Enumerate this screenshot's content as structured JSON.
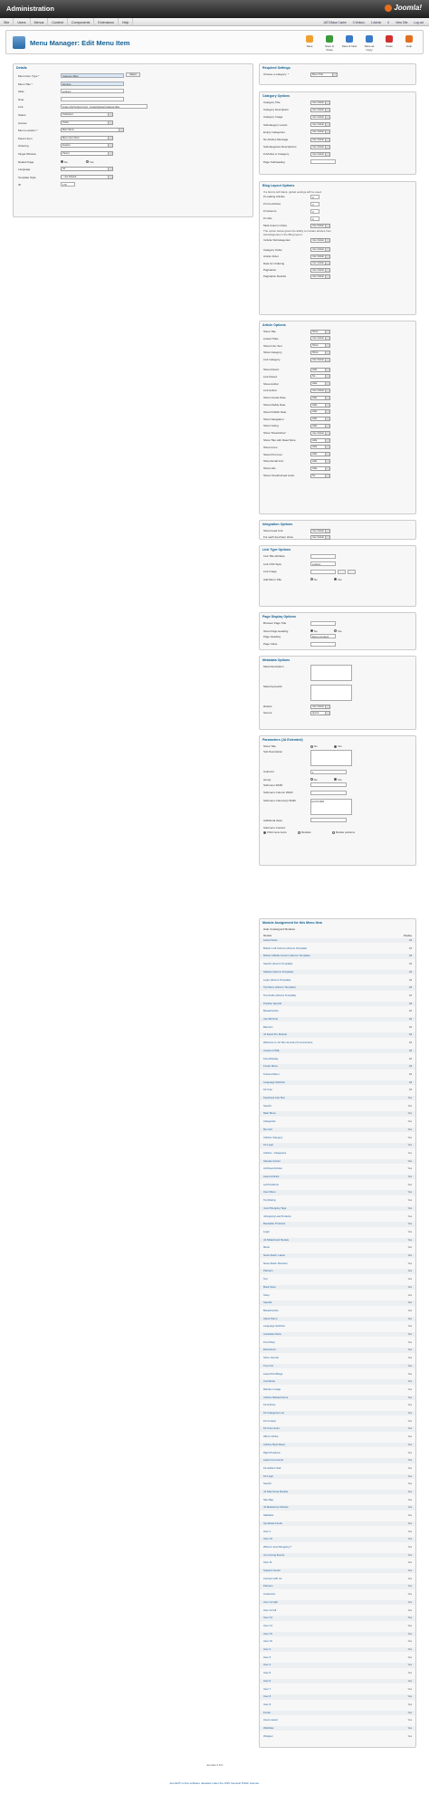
{
  "header": {
    "title": "Administration",
    "logo": "Joomla!"
  },
  "menubar": {
    "items": [
      "Site",
      "Users",
      "Menus",
      "Content",
      "Components",
      "Extensions",
      "Help"
    ],
    "right": [
      "JAT3 Base Cache",
      "0 Visitors",
      "1 Admin",
      "0",
      "View Site",
      "Log out"
    ]
  },
  "toolbar": {
    "page_title": "Menu Manager: Edit Menu Item",
    "buttons": [
      "Save",
      "Save & Close",
      "Save & New",
      "Save as Copy",
      "Close",
      "Help"
    ]
  },
  "details": {
    "title": "Details",
    "fields": [
      {
        "label": "Menu Item Type *",
        "value": "Category Blog",
        "kind": "ro"
      },
      {
        "label": "Menu Title *",
        "value": "Explore",
        "kind": "ro"
      },
      {
        "label": "Alias",
        "value": "explore",
        "kind": "input"
      },
      {
        "label": "Note",
        "value": "",
        "kind": "input"
      },
      {
        "label": "Link",
        "value": "index.php?option=com_content&view=category&la",
        "kind": "input"
      },
      {
        "label": "Status",
        "value": "Published",
        "kind": "select"
      },
      {
        "label": "Access",
        "value": "Public",
        "kind": "select"
      },
      {
        "label": "Menu Location *",
        "value": "Main Menu",
        "kind": "select"
      },
      {
        "label": "Parent Item",
        "value": "Menu Item Root",
        "kind": "select"
      },
      {
        "label": "Ordering",
        "value": "Explore",
        "kind": "select"
      },
      {
        "label": "Target Window",
        "value": "Parent",
        "kind": "select"
      },
      {
        "label": "Default Page",
        "value": "",
        "kind": "radio"
      },
      {
        "label": "Language",
        "value": "All",
        "kind": "select"
      },
      {
        "label": "Template Style",
        "value": "- Use Default -",
        "kind": "select"
      },
      {
        "label": "ID",
        "value": "176",
        "kind": "input"
      }
    ],
    "select_btn": "Select",
    "radio_no": "No",
    "radio_yes": "Yes"
  },
  "sections": [
    {
      "title": "Required Settings",
      "rows": [
        [
          "Choose a category: *",
          "Menu Title"
        ]
      ]
    },
    {
      "title": "Category Options",
      "rows": [
        [
          "Category Title",
          "Use Global"
        ],
        [
          "Category Description",
          "Use Global"
        ],
        [
          "Category Image",
          "Use Global"
        ],
        [
          "Subcategory Levels",
          "Use Global"
        ],
        [
          "Empty Categories",
          "Use Global"
        ],
        [
          "No Articles Message",
          "Use Global"
        ],
        [
          "Subcategories Descriptions",
          "Use Global"
        ],
        [
          "# Articles in Category",
          "Use Global"
        ],
        [
          "Page Subheading",
          ""
        ]
      ]
    },
    {
      "title": "Blog Layout Options",
      "note": "If a field is left blank, global settings will be used.",
      "rows": [
        [
          "# Leading Articles",
          "0"
        ],
        [
          "# Intro Articles",
          "3"
        ],
        [
          "# Columns",
          "3"
        ],
        [
          "# Links",
          "0"
        ],
        [
          "Multi Column Order",
          "Use Global"
        ],
        [
          "Include Subcategories",
          "Use Global"
        ],
        [
          "Category Order",
          "Use Global"
        ],
        [
          "Article Order",
          "Use Global"
        ],
        [
          "Date for Ordering",
          "Use Global"
        ],
        [
          "Pagination",
          "Use Global"
        ],
        [
          "Pagination Results",
          "Use Global"
        ]
      ],
      "note2": "The option below gives the ability to include articles from subcategories in the Blog layout."
    },
    {
      "title": "Article Options",
      "rows": [
        [
          "Show Title",
          "Show"
        ],
        [
          "Linked Titles",
          "Use Global"
        ],
        [
          "Show Intro Text",
          "Show"
        ],
        [
          "Show Category",
          "Show"
        ],
        [
          "Link Category",
          "Use Global"
        ],
        [
          "Show Parent",
          "Hide"
        ],
        [
          "Link Parent",
          "No"
        ],
        [
          "Show Author",
          "Hide"
        ],
        [
          "Link Author",
          "Use Global"
        ],
        [
          "Show Create Date",
          "Hide"
        ],
        [
          "Show Modify Date",
          "Hide"
        ],
        [
          "Show Publish Date",
          "Hide"
        ],
        [
          "Show Navigation",
          "Hide"
        ],
        [
          "Show Voting",
          "Hide"
        ],
        [
          "Show \"Read More\"",
          "Use Global"
        ],
        [
          "Show Title with Read More",
          "Hide"
        ],
        [
          "Show Icons",
          "Hide"
        ],
        [
          "Show Print Icon",
          "Hide"
        ],
        [
          "Show Email Icon",
          "Hide"
        ],
        [
          "Show Hits",
          "Hide"
        ],
        [
          "Show Unauthorised Links",
          "No"
        ]
      ]
    },
    {
      "title": "Integration Options",
      "rows": [
        [
          "Show Feed Link",
          "Use Global"
        ],
        [
          "For each feed item show",
          "Use Global"
        ]
      ]
    },
    {
      "title": "Link Type Options",
      "rows": [
        [
          "Link Title Attribute",
          ""
        ],
        [
          "Link CSS Style",
          "explore"
        ],
        [
          "Link Image",
          ""
        ],
        [
          "Add Menu Title",
          ""
        ]
      ]
    },
    {
      "title": "Page Display Options",
      "rows": [
        [
          "Browser Page Title",
          ""
        ],
        [
          "Show Page Heading",
          ""
        ],
        [
          "Page Heading",
          "Demo Content"
        ],
        [
          "Page Class",
          ""
        ]
      ]
    },
    {
      "title": "Metadata Options",
      "rows": [
        [
          "Meta Description",
          ""
        ],
        [
          "Meta Keywords",
          ""
        ],
        [
          "Robots",
          "Use Global"
        ],
        [
          "Secure",
          "Ignore"
        ]
      ]
    },
    {
      "title": "Parameters (JA Extended)",
      "rows": [
        [
          "Show Title",
          ""
        ],
        [
          "Sub Description",
          ""
        ],
        [
          "Columns",
          "1"
        ],
        [
          "Group",
          ""
        ],
        [
          "Submenu Width",
          ""
        ],
        [
          "Submenu Column Width",
          ""
        ],
        [
          "Submenu Column(s) Width",
          "col=0=300"
        ],
        [
          "Additional class",
          ""
        ],
        [
          "Submenu Content",
          ""
        ]
      ],
      "submenu_opts": [
        "Child menu items",
        "Modules",
        "Module positions"
      ]
    }
  ],
  "modules": {
    "title": "Module Assignment for this Menu Item",
    "hide": "Hide Unassigned Modules",
    "col1": "Module",
    "col2": "Display",
    "rows": [
      [
        "Latest News",
        "position-7",
        "All"
      ],
      [
        "Bottom Left Column (Akomo Template)",
        "",
        "All"
      ],
      [
        "Bottom Middle Column (Akomo Template)",
        "",
        "All"
      ],
      [
        "Search (Akomo Template)",
        "",
        "All"
      ],
      [
        "Sidebar (Akomo Template)",
        "",
        "All"
      ],
      [
        "Login (Akomo Template)",
        "",
        "All"
      ],
      [
        "Top Menu (Akomo Template)",
        "",
        "All"
      ],
      [
        "Top Guide (Akomo Template)",
        "",
        "All"
      ],
      [
        "Position Special",
        "",
        "All"
      ],
      [
        "Breadcrumbs",
        "",
        "All"
      ],
      [
        "Cat Tab Post",
        "",
        "All"
      ],
      [
        "Banners",
        "",
        "All"
      ],
      [
        "JA News Pro Module",
        "",
        "All"
      ],
      [
        "Welcome to JA Tiris Joomla 2.5 ecommerce",
        "",
        "All"
      ],
      [
        "Custom HTML",
        "",
        "All"
      ],
      [
        "Feed Display",
        "",
        "All"
      ],
      [
        "Footer Menu",
        "",
        "All"
      ],
      [
        "Kunena Menu",
        "",
        "All"
      ],
      [
        "Language Switcher",
        "",
        "All"
      ],
      [
        "K2 User",
        "",
        "All"
      ],
      [
        "Facebook Like Box",
        "",
        "Yes"
      ],
      [
        "Search",
        "",
        "Yes"
      ],
      [
        "Main Menu",
        "",
        "Yes"
      ],
      [
        "Categories",
        "",
        "Yes"
      ],
      [
        "My Cart",
        "",
        "Yes"
      ],
      [
        "Articles Category",
        "",
        "Yes"
      ],
      [
        "K2 Login",
        "",
        "Yes"
      ],
      [
        "Articles - Categories",
        "",
        "Yes"
      ],
      [
        "Sample Carrier",
        "",
        "Yes"
      ],
      [
        "Archived Articles",
        "",
        "Yes"
      ],
      [
        "Latest Articles",
        "",
        "Yes"
      ],
      [
        "Left Positions",
        "",
        "Yes"
      ],
      [
        "User Menu",
        "",
        "Yes"
      ],
      [
        "Top Rating",
        "",
        "Yes"
      ],
      [
        "JoomShopping Tags",
        "",
        "Yes"
      ],
      [
        "Jshopping Last Products",
        "",
        "Yes"
      ],
      [
        "Bestseller Products",
        "",
        "Yes"
      ],
      [
        "Login",
        "",
        "Yes"
      ],
      [
        "JA Slideshow2 Module",
        "",
        "Yes"
      ],
      [
        "Menu",
        "",
        "Yes"
      ],
      [
        "News Flash: Latest",
        "",
        "Yes"
      ],
      [
        "News Flash: Random",
        "",
        "Yes"
      ],
      [
        "Partners",
        "",
        "Yes"
      ],
      [
        "Top",
        "",
        "Yes"
      ],
      [
        "Book Store",
        "",
        "Yes"
      ],
      [
        "Shop",
        "",
        "Yes"
      ],
      [
        "Special",
        "",
        "Yes"
      ],
      [
        "Breadcrumbs",
        "",
        "Yes"
      ],
      [
        "About Pamo",
        "",
        "Yes"
      ],
      [
        "Language Switcher",
        "",
        "Yes"
      ],
      [
        "Australian Parts",
        "",
        "Yes"
      ],
      [
        "Find Shop",
        "",
        "Yes"
      ],
      [
        "Extensions",
        "",
        "Yes"
      ],
      [
        "Store Journal",
        "",
        "Yes"
      ],
      [
        "Tree Inst",
        "",
        "Yes"
      ],
      [
        "Latest Part Blogs",
        "",
        "Yes"
      ],
      [
        "Contribute",
        "",
        "Yes"
      ],
      [
        "Random Image",
        "",
        "Yes"
      ],
      [
        "Articles Related Items",
        "",
        "Yes"
      ],
      [
        "K2 Archive",
        "",
        "Yes"
      ],
      [
        "K2 Categories List",
        "",
        "Yes"
      ],
      [
        "K2 Content",
        "",
        "Yes"
      ],
      [
        "K2 Comments",
        "",
        "Yes"
      ],
      [
        "Who's Online",
        "",
        "Yes"
      ],
      [
        "Articles Most Read",
        "",
        "Yes"
      ],
      [
        "Right Positions",
        "",
        "Yes"
      ],
      [
        "Latest Comments",
        "",
        "Yes"
      ],
      [
        "K2 authors Stat",
        "",
        "Yes"
      ],
      [
        "K2 Login",
        "",
        "Yes"
      ],
      [
        "Search",
        "",
        "Yes"
      ],
      [
        "JA Side News Module",
        "",
        "Yes"
      ],
      [
        "Site Map",
        "",
        "Yes"
      ],
      [
        "JA Masterlove Module",
        "",
        "Yes"
      ],
      [
        "Statistics",
        "",
        "Yes"
      ],
      [
        "Syndicate Feeds",
        "",
        "Yes"
      ],
      [
        "User 1",
        "",
        "Yes"
      ],
      [
        "User 10",
        "",
        "Yes"
      ],
      [
        "What is JoomShopping ?",
        "",
        "Yes"
      ],
      [
        "Up Coming Events",
        "",
        "Yes"
      ],
      [
        "User 11",
        "",
        "Yes"
      ],
      [
        "Support Center",
        "",
        "Yes"
      ],
      [
        "Connect with Us",
        "",
        "Yes"
      ],
      [
        "Partners",
        "",
        "Yes"
      ],
      [
        "Customize",
        "",
        "Yes"
      ],
      [
        "User 12 right",
        "",
        "Yes"
      ],
      [
        "User 12 left",
        "",
        "Yes"
      ],
      [
        "User 13",
        "",
        "Yes"
      ],
      [
        "User 14",
        "",
        "Yes"
      ],
      [
        "User 15",
        "",
        "Yes"
      ],
      [
        "User 16",
        "",
        "Yes"
      ],
      [
        "User 2",
        "",
        "Yes"
      ],
      [
        "User 3",
        "",
        "Yes"
      ],
      [
        "User 4",
        "",
        "Yes"
      ],
      [
        "User 5",
        "",
        "Yes"
      ],
      [
        "User 6",
        "",
        "Yes"
      ],
      [
        "User 7",
        "",
        "Yes"
      ],
      [
        "User 8",
        "",
        "Yes"
      ],
      [
        "User 9",
        "",
        "Yes"
      ],
      [
        "Footer",
        "",
        "Yes"
      ],
      [
        "Users Latest",
        "",
        "Yes"
      ],
      [
        "Weblinks",
        "",
        "Yes"
      ],
      [
        "Wrapper",
        "",
        "Yes"
      ]
    ]
  },
  "footer": {
    "version": "Joomla! 2.5.6",
    "license": "Joomla!® is free software released under the GNU General Public License."
  }
}
